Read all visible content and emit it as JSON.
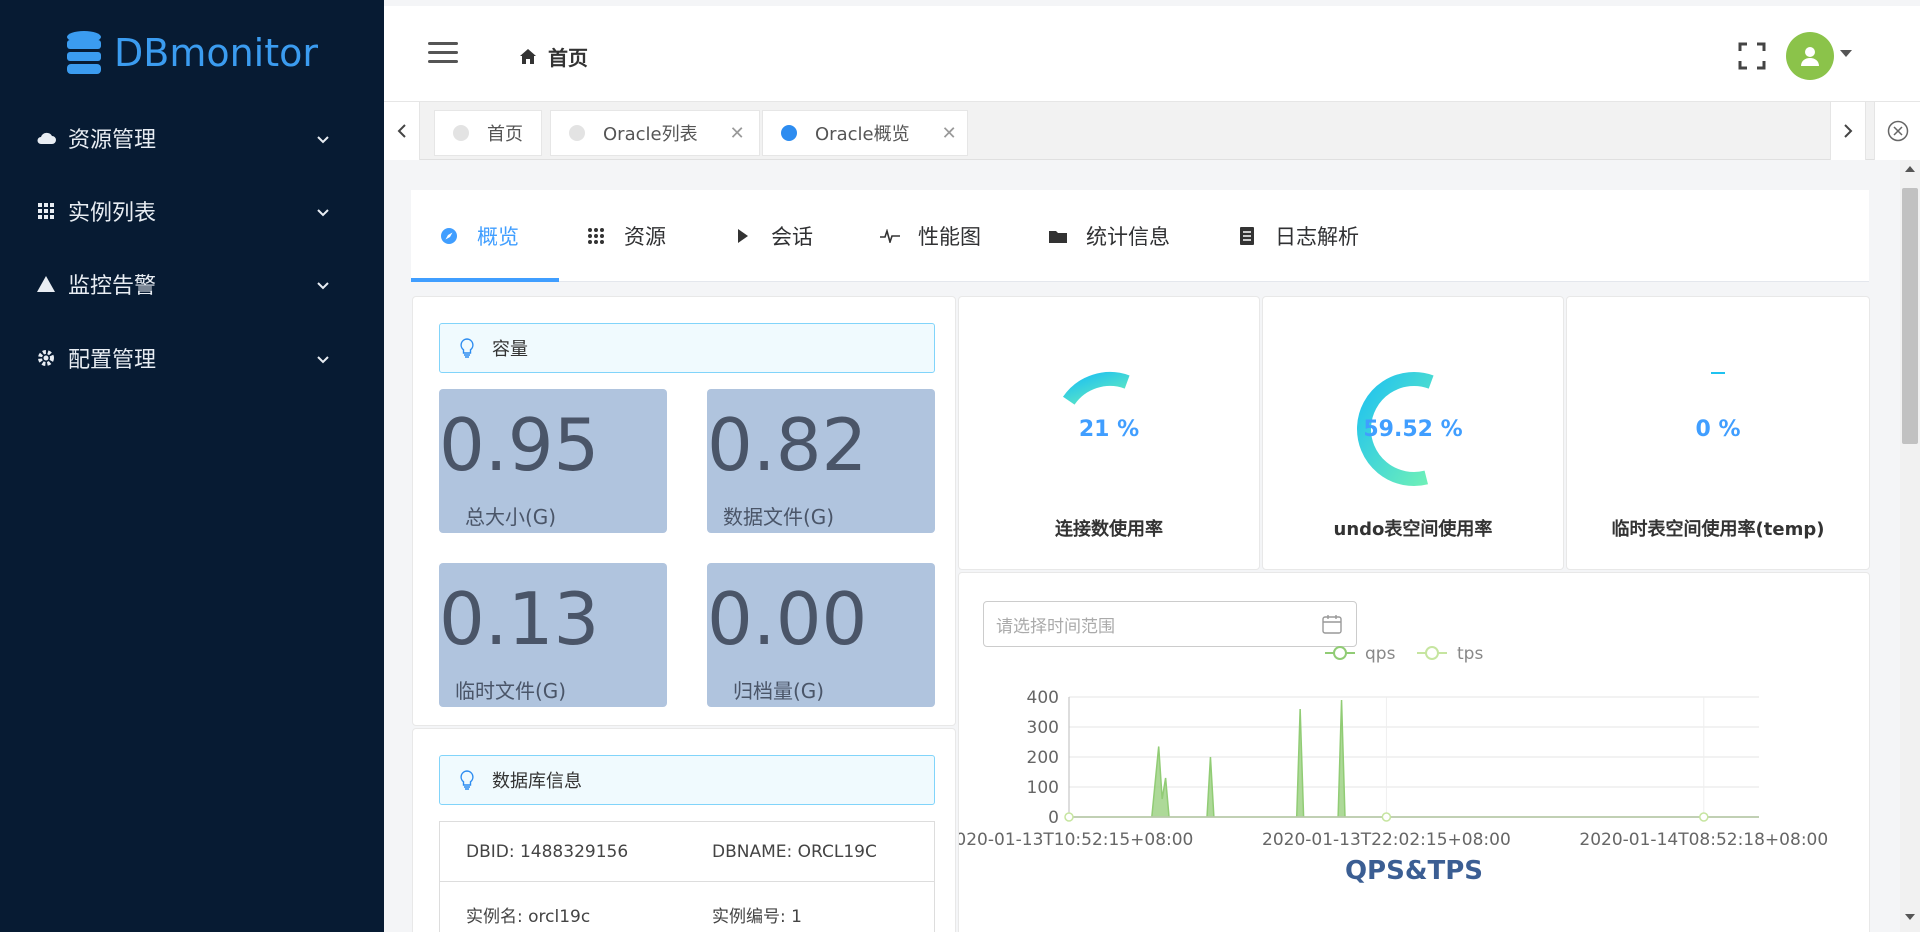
{
  "app": {
    "logo_text": "DBmonitor"
  },
  "sidebar": {
    "items": [
      {
        "label": "资源管理",
        "icon": "cloud-icon"
      },
      {
        "label": "实例列表",
        "icon": "grid-icon"
      },
      {
        "label": "监控告警",
        "icon": "warning-icon"
      },
      {
        "label": "配置管理",
        "icon": "gear-icon"
      }
    ]
  },
  "header": {
    "breadcrumb": "首页"
  },
  "tabs": [
    {
      "label": "首页",
      "closable": false,
      "active": false
    },
    {
      "label": "Oracle列表",
      "closable": true,
      "active": false
    },
    {
      "label": "Oracle概览",
      "closable": true,
      "active": true
    }
  ],
  "page_tabs": [
    {
      "label": "概览",
      "icon": "compass-icon"
    },
    {
      "label": "资源",
      "icon": "grid-icon"
    },
    {
      "label": "会话",
      "icon": "play-icon"
    },
    {
      "label": "性能图",
      "icon": "pulse-icon"
    },
    {
      "label": "统计信息",
      "icon": "folder-icon"
    },
    {
      "label": "日志解析",
      "icon": "document-icon"
    }
  ],
  "capacity": {
    "title": "容量",
    "items": [
      {
        "value": "0.95",
        "label": "总大小(G)"
      },
      {
        "value": "0.82",
        "label": "数据文件(G)"
      },
      {
        "value": "0.13",
        "label": "临时文件(G)"
      },
      {
        "value": "0.00",
        "label": "归档量(G)"
      }
    ]
  },
  "gauges": [
    {
      "pct_text": "21 %",
      "value": 21,
      "title": "连接数使用率"
    },
    {
      "pct_text": "59.52 %",
      "value": 59.52,
      "title": "undo表空间使用率"
    },
    {
      "pct_text": "0 %",
      "value": 0,
      "title": "临时表空间使用率(temp)"
    }
  ],
  "dbinfo": {
    "title": "数据库信息",
    "rows": [
      {
        "left": "DBID: 1488329156",
        "right": "DBNAME: ORCL19C"
      },
      {
        "left": "实例名: orcl19c",
        "right": "实例编号: 1"
      }
    ]
  },
  "chart_panel": {
    "date_placeholder": "请选择时间范围"
  },
  "chart_data": {
    "type": "area",
    "title": "QPS&TPS",
    "legend": [
      "qps",
      "tps"
    ],
    "legend_position": "top-center",
    "x_tick_labels": [
      "2020-01-13T10:52:15+08:00",
      "2020-01-13T22:02:15+08:00",
      "2020-01-14T08:52:18+08:00"
    ],
    "ylim": [
      0,
      400
    ],
    "y_ticks": [
      0,
      100,
      200,
      300,
      400
    ],
    "series": [
      {
        "name": "qps",
        "color": "#91cc75",
        "points": [
          [
            0.0,
            0
          ],
          [
            0.12,
            0
          ],
          [
            0.13,
            235
          ],
          [
            0.135,
            60
          ],
          [
            0.14,
            130
          ],
          [
            0.145,
            0
          ],
          [
            0.2,
            0
          ],
          [
            0.205,
            200
          ],
          [
            0.21,
            0
          ],
          [
            0.33,
            0
          ],
          [
            0.335,
            360
          ],
          [
            0.34,
            0
          ],
          [
            0.39,
            0
          ],
          [
            0.395,
            390
          ],
          [
            0.4,
            0
          ],
          [
            1.0,
            0
          ]
        ]
      },
      {
        "name": "tps",
        "color": "#c6e5a0",
        "points": [
          [
            0.0,
            0
          ],
          [
            1.0,
            0
          ]
        ]
      }
    ],
    "grid": true
  },
  "colors": {
    "sidebar_bg": "#071b33",
    "accent": "#409eff",
    "logo": "#3b9cf0",
    "capacity_box": "#b0c4de"
  }
}
